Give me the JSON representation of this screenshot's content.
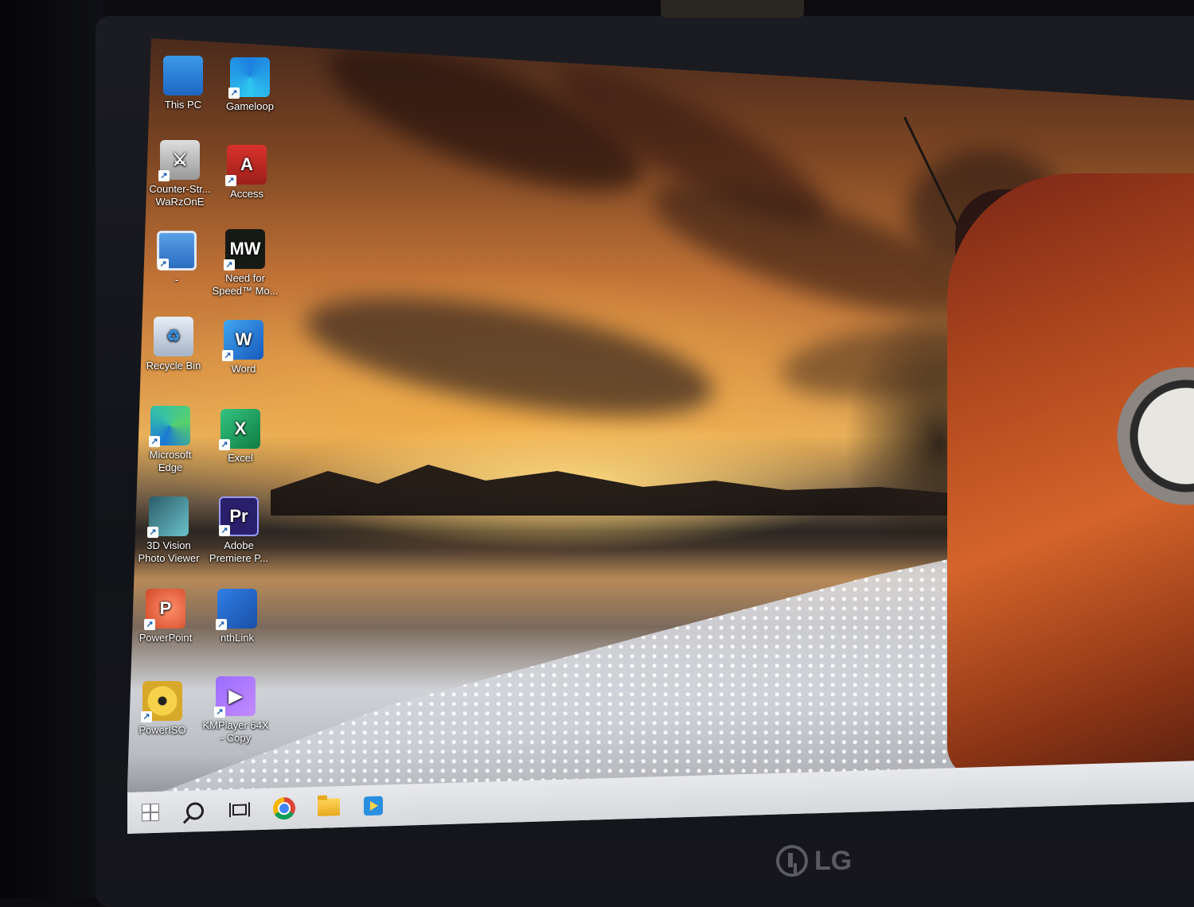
{
  "desktop": {
    "icons": [
      {
        "label": "This PC",
        "glyph": ""
      },
      {
        "label": "Gameloop",
        "glyph": ""
      },
      {
        "label": "Counter-Str...\nWaRzOnE",
        "glyph": "⚔"
      },
      {
        "label": "Access",
        "glyph": "A"
      },
      {
        "label": "-",
        "glyph": ""
      },
      {
        "label": "Need for\nSpeed™ Mo...",
        "glyph": "MW"
      },
      {
        "label": "Recycle Bin",
        "glyph": "♻"
      },
      {
        "label": "Word",
        "glyph": "W"
      },
      {
        "label": "Microsoft\nEdge",
        "glyph": ""
      },
      {
        "label": "Excel",
        "glyph": "X"
      },
      {
        "label": "3D Vision\nPhoto Viewer",
        "glyph": ""
      },
      {
        "label": "Adobe\nPremiere P...",
        "glyph": "Pr"
      },
      {
        "label": "PowerPoint",
        "glyph": "P"
      },
      {
        "label": "nthLink",
        "glyph": ""
      },
      {
        "label": "PowerISO",
        "glyph": ""
      },
      {
        "label": "KMPlayer 64X\n- Copy",
        "glyph": "▶"
      }
    ],
    "shortcut_arrow": "↗"
  },
  "taskbar": {
    "items": [
      {
        "name": "start",
        "icon": "windows-logo-icon"
      },
      {
        "name": "search",
        "icon": "search-icon"
      },
      {
        "name": "task-view",
        "icon": "task-view-icon"
      },
      {
        "name": "chrome",
        "icon": "chrome-icon"
      },
      {
        "name": "file-explorer",
        "icon": "folder-icon"
      },
      {
        "name": "media-player",
        "icon": "media-player-icon"
      }
    ]
  },
  "monitor": {
    "brand": "LG"
  }
}
